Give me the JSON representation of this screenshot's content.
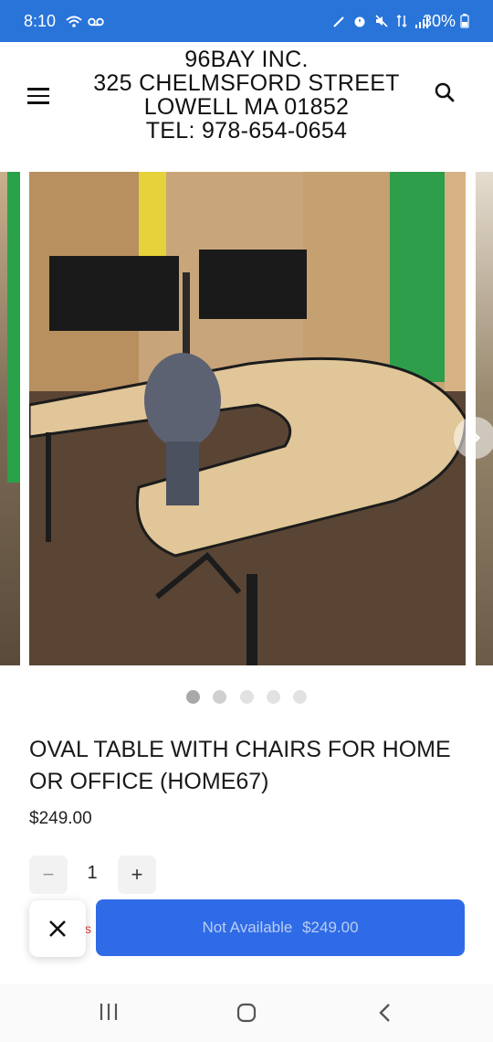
{
  "status_bar": {
    "time": "8:10",
    "battery": "30%",
    "left_icons": [
      "wifi-calling-icon",
      "voicemail-icon"
    ],
    "right_icons": [
      "pen-icon",
      "alarm-icon",
      "mute-icon",
      "data-icon",
      "signal-icon",
      "battery-icon"
    ]
  },
  "header": {
    "line1": "96BAY INC.",
    "line2": "325 CHELMSFORD STREET",
    "line3": "LOWELL MA 01852",
    "line4": "TEL: 978-654-0654"
  },
  "gallery": {
    "slide_count": 5,
    "active_index": 0
  },
  "product": {
    "title": "OVAL TABLE WITH CHAIRS FOR HOME OR OFFICE (HOME67)",
    "price": "$249.00"
  },
  "quantity": {
    "value": "1",
    "minus": "−",
    "plus": "+"
  },
  "buy_button": {
    "label": "Not Available",
    "price": "$249.00"
  },
  "colors": {
    "status_bar": "#2874d9",
    "buy_button": "#2f6be6",
    "buy_button_text": "#b9cdf6"
  }
}
